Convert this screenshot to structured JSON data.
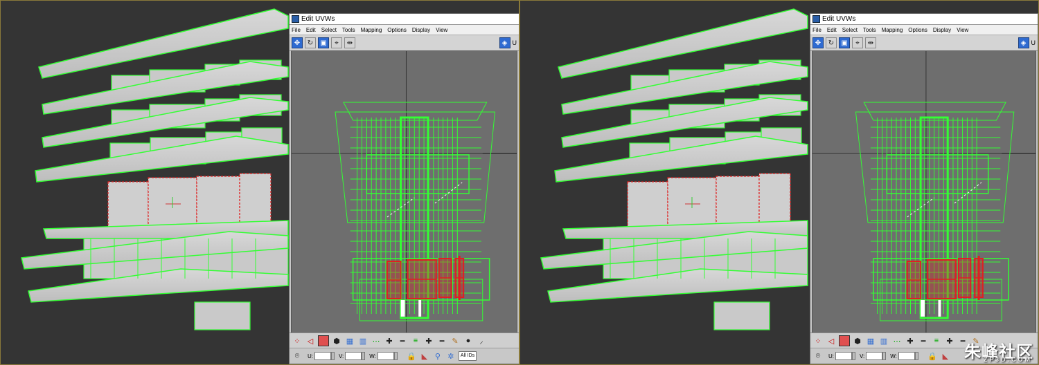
{
  "editor": {
    "title": "Edit UVWs",
    "menu": [
      "File",
      "Edit",
      "Select",
      "Tools",
      "Mapping",
      "Options",
      "Display",
      "View"
    ],
    "truncated_label": "U",
    "status": {
      "u_label": "U:",
      "v_label": "V:",
      "w_label": "W:",
      "ids_label": "All IDs"
    }
  },
  "watermark": {
    "text": "朱峰社区",
    "sub": "ZF3D.COM"
  },
  "colors": {
    "viewport_bg": "#343434",
    "wire": "#33ff33",
    "selection": "#e02020",
    "uvw_canvas": "#6e6e6e",
    "accent": "#2f6bd1"
  }
}
